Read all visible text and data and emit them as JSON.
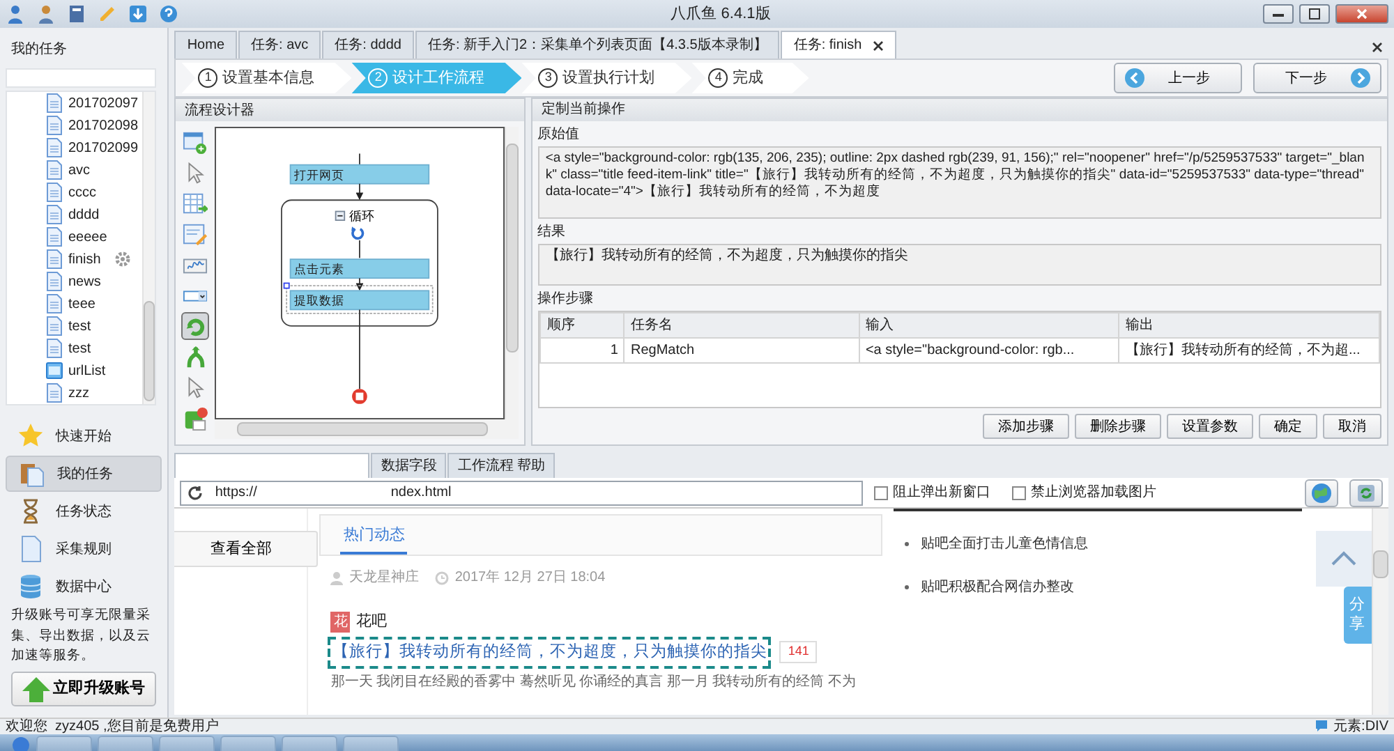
{
  "window": {
    "title": "八爪鱼 6.4.1版"
  },
  "sidebar": {
    "heading": "我的任务",
    "tree": [
      {
        "label": "201702097",
        "kind": "page",
        "hovered": false
      },
      {
        "label": "201702098",
        "kind": "page",
        "hovered": false
      },
      {
        "label": "201702099",
        "kind": "page",
        "hovered": false
      },
      {
        "label": "avc",
        "kind": "page",
        "hovered": false
      },
      {
        "label": "cccc",
        "kind": "page",
        "hovered": false
      },
      {
        "label": "dddd",
        "kind": "page",
        "hovered": false
      },
      {
        "label": "eeeee",
        "kind": "page",
        "hovered": false
      },
      {
        "label": "finish",
        "kind": "page",
        "hovered": true
      },
      {
        "label": "news",
        "kind": "page",
        "hovered": false
      },
      {
        "label": "teee",
        "kind": "page",
        "hovered": false
      },
      {
        "label": "test",
        "kind": "page",
        "hovered": false
      },
      {
        "label": "test",
        "kind": "page",
        "hovered": false
      },
      {
        "label": "urlList",
        "kind": "list",
        "hovered": false
      },
      {
        "label": "zzz",
        "kind": "page",
        "hovered": false
      }
    ],
    "nav": [
      {
        "label": "快速开始",
        "kind": "star",
        "selected": false
      },
      {
        "label": "我的任务",
        "kind": "tasks",
        "selected": true
      },
      {
        "label": "任务状态",
        "kind": "hourglass",
        "selected": false
      },
      {
        "label": "采集规则",
        "kind": "rules",
        "selected": false
      },
      {
        "label": "数据中心",
        "kind": "data",
        "selected": false
      }
    ],
    "upgrade_note": "升级账号可享无限量采集、导出数据，以及云加速等服务。",
    "upgrade_button": "立即升级账号"
  },
  "doc_tabs": [
    {
      "label": "Home",
      "selected": false,
      "closable": false
    },
    {
      "label": "任务: avc",
      "selected": false,
      "closable": false
    },
    {
      "label": "任务: dddd",
      "selected": false,
      "closable": false
    },
    {
      "label": "任务: 新手入门2：采集单个列表页面【4.3.5版本录制】",
      "selected": false,
      "closable": false
    },
    {
      "label": "任务: finish",
      "selected": true,
      "closable": true
    }
  ],
  "wizard": {
    "steps": [
      {
        "number": "1",
        "label": "设置基本信息",
        "selected": false
      },
      {
        "number": "2",
        "label": "设计工作流程",
        "selected": true
      },
      {
        "number": "3",
        "label": "设置执行计划",
        "selected": false
      },
      {
        "number": "4",
        "label": "完成",
        "selected": false
      }
    ],
    "prev": "上一步",
    "next": "下一步"
  },
  "designer": {
    "title": "流程设计器",
    "tools": [
      {
        "kind": "add-page",
        "selected": false
      },
      {
        "kind": "pointer",
        "selected": false
      },
      {
        "kind": "table",
        "selected": false
      },
      {
        "kind": "form",
        "selected": false
      },
      {
        "kind": "captcha",
        "selected": false
      },
      {
        "kind": "dropdown",
        "selected": false
      },
      {
        "kind": "loop",
        "selected": true
      },
      {
        "kind": "branch",
        "selected": false
      },
      {
        "kind": "pointer",
        "selected": false
      },
      {
        "kind": "end",
        "selected": false
      }
    ],
    "flow": [
      {
        "label": "打开网页",
        "kind": "step",
        "selected": false
      },
      {
        "label": "循环",
        "kind": "loop",
        "expanded": true,
        "children": [
          {
            "label": "点击元素",
            "kind": "step",
            "selected": false
          },
          {
            "label": "提取数据",
            "kind": "step",
            "selected": true
          }
        ]
      }
    ]
  },
  "operation": {
    "title": "定制当前操作",
    "raw_label": "原始值",
    "raw_value": "<a style=\"background-color: rgb(135, 206, 235); outline: 2px dashed rgb(239, 91, 156);\" rel=\"noopener\" href=\"/p/5259537533\" target=\"_blank\" class=\"title feed-item-link\" title=\"【旅行】我转动所有的经筒，不为超度，只为触摸你的指尖\" data-id=\"5259537533\" data-type=\"thread\" data-locate=\"4\">【旅行】我转动所有的经筒，不为超度",
    "result_label": "结果",
    "result_value": "【旅行】我转动所有的经筒，不为超度，只为触摸你的指尖",
    "steps_label": "操作步骤",
    "columns": [
      "顺序",
      "任务名",
      "输入",
      "输出"
    ],
    "rows": [
      [
        "1",
        "RegMatch",
        "<a style=\"background-color: rgb...",
        "【旅行】我转动所有的经筒，不为超..."
      ]
    ],
    "buttons": [
      "添加步骤",
      "删除步骤",
      "设置参数",
      "确定",
      "取消"
    ]
  },
  "bottom_tabs": [
    {
      "selected": true
    },
    {
      "label": "数据字段",
      "selected": false
    },
    {
      "label": "工作流程 帮助",
      "selected": false
    }
  ],
  "browser": {
    "url_start": "https://",
    "url_end": "ndex.html",
    "options": [
      {
        "label": "阻止弹出新窗口",
        "checked": false
      },
      {
        "label": "禁止浏览器加载图片",
        "checked": false
      }
    ],
    "page": {
      "view_all": "查看全部",
      "tab": "热门动态",
      "author": "天龙星神庄",
      "time": "2017年 12月 27日 18:04",
      "forum_tag": "花",
      "forum": "花吧",
      "title": "【旅行】我转动所有的经筒，不为超度，只为触摸你的指尖",
      "reply_count": "141",
      "excerpt": "那一天 我闭目在经殿的香雾中 蓦然听见 你诵经的真言 那一月 我转动所有的经筒 不为",
      "notices": [
        "贴吧全面打击儿童色情信息",
        "贴吧积极配合网信办整改"
      ],
      "share": "分享"
    }
  },
  "status_bar": {
    "welcome": "欢迎您  zyz405 ,您目前是免费用户",
    "element": "元素:DIV"
  }
}
